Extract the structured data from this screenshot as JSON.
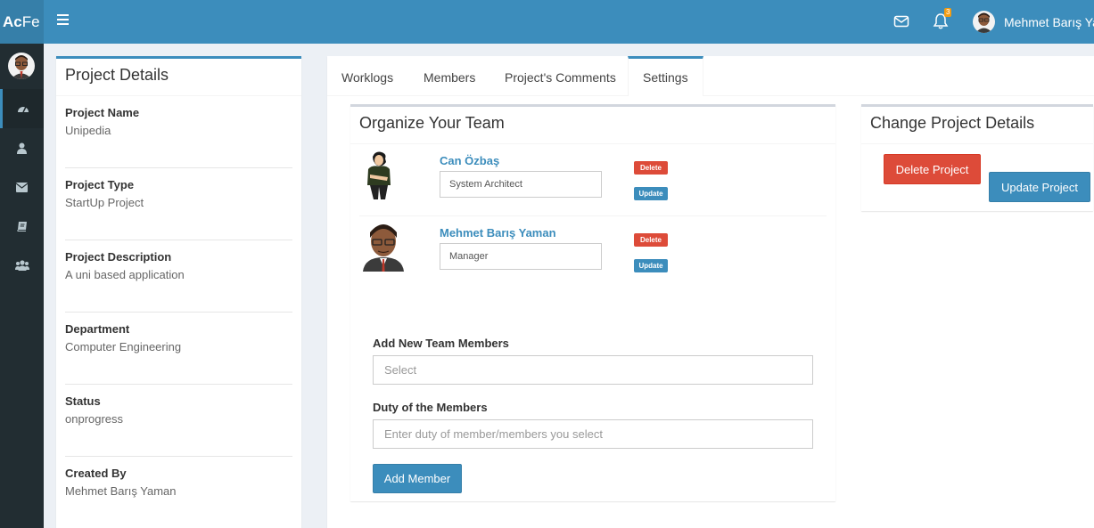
{
  "header": {
    "logo_bold": "Ac",
    "logo_rest": "Fe",
    "bell_count": "3",
    "user_name": "Mehmet Barış Yaman"
  },
  "sidebar": {
    "items": [
      "dashboard-icon",
      "user-icon",
      "envelope-icon",
      "book-icon",
      "users-icon"
    ]
  },
  "project_details": {
    "title": "Project Details",
    "items": [
      {
        "label": "Project Name",
        "value": "Unipedia"
      },
      {
        "label": "Project Type",
        "value": "StartUp Project"
      },
      {
        "label": "Project Description",
        "value": "A uni based application"
      },
      {
        "label": "Department",
        "value": "Computer Engineering"
      },
      {
        "label": "Status",
        "value": "onprogress"
      },
      {
        "label": "Created By",
        "value": "Mehmet Barış Yaman"
      }
    ]
  },
  "tabs": [
    {
      "label": "Worklogs",
      "active": false
    },
    {
      "label": "Members",
      "active": false
    },
    {
      "label": "Project's Comments",
      "active": false
    },
    {
      "label": "Settings",
      "active": true
    }
  ],
  "team": {
    "title": "Organize Your Team",
    "members": [
      {
        "name": "Can Özbaş",
        "duty": "System Architect",
        "delete_label": "Delete",
        "update_label": "Update"
      },
      {
        "name": "Mehmet Barış Yaman",
        "duty": "Manager",
        "delete_label": "Delete",
        "update_label": "Update"
      }
    ],
    "add_label": "Add New Team Members",
    "select_placeholder": "Select",
    "duty_label": "Duty of the Members",
    "duty_placeholder": "Enter duty of member/members you select",
    "add_button": "Add Member"
  },
  "change": {
    "title": "Change Project Details",
    "delete_button": "Delete Project",
    "update_button": "Update Project"
  },
  "colors": {
    "primary": "#3c8dbc",
    "danger": "#dd4b39",
    "sidebar": "#222d32",
    "badge": "#f39c12"
  }
}
